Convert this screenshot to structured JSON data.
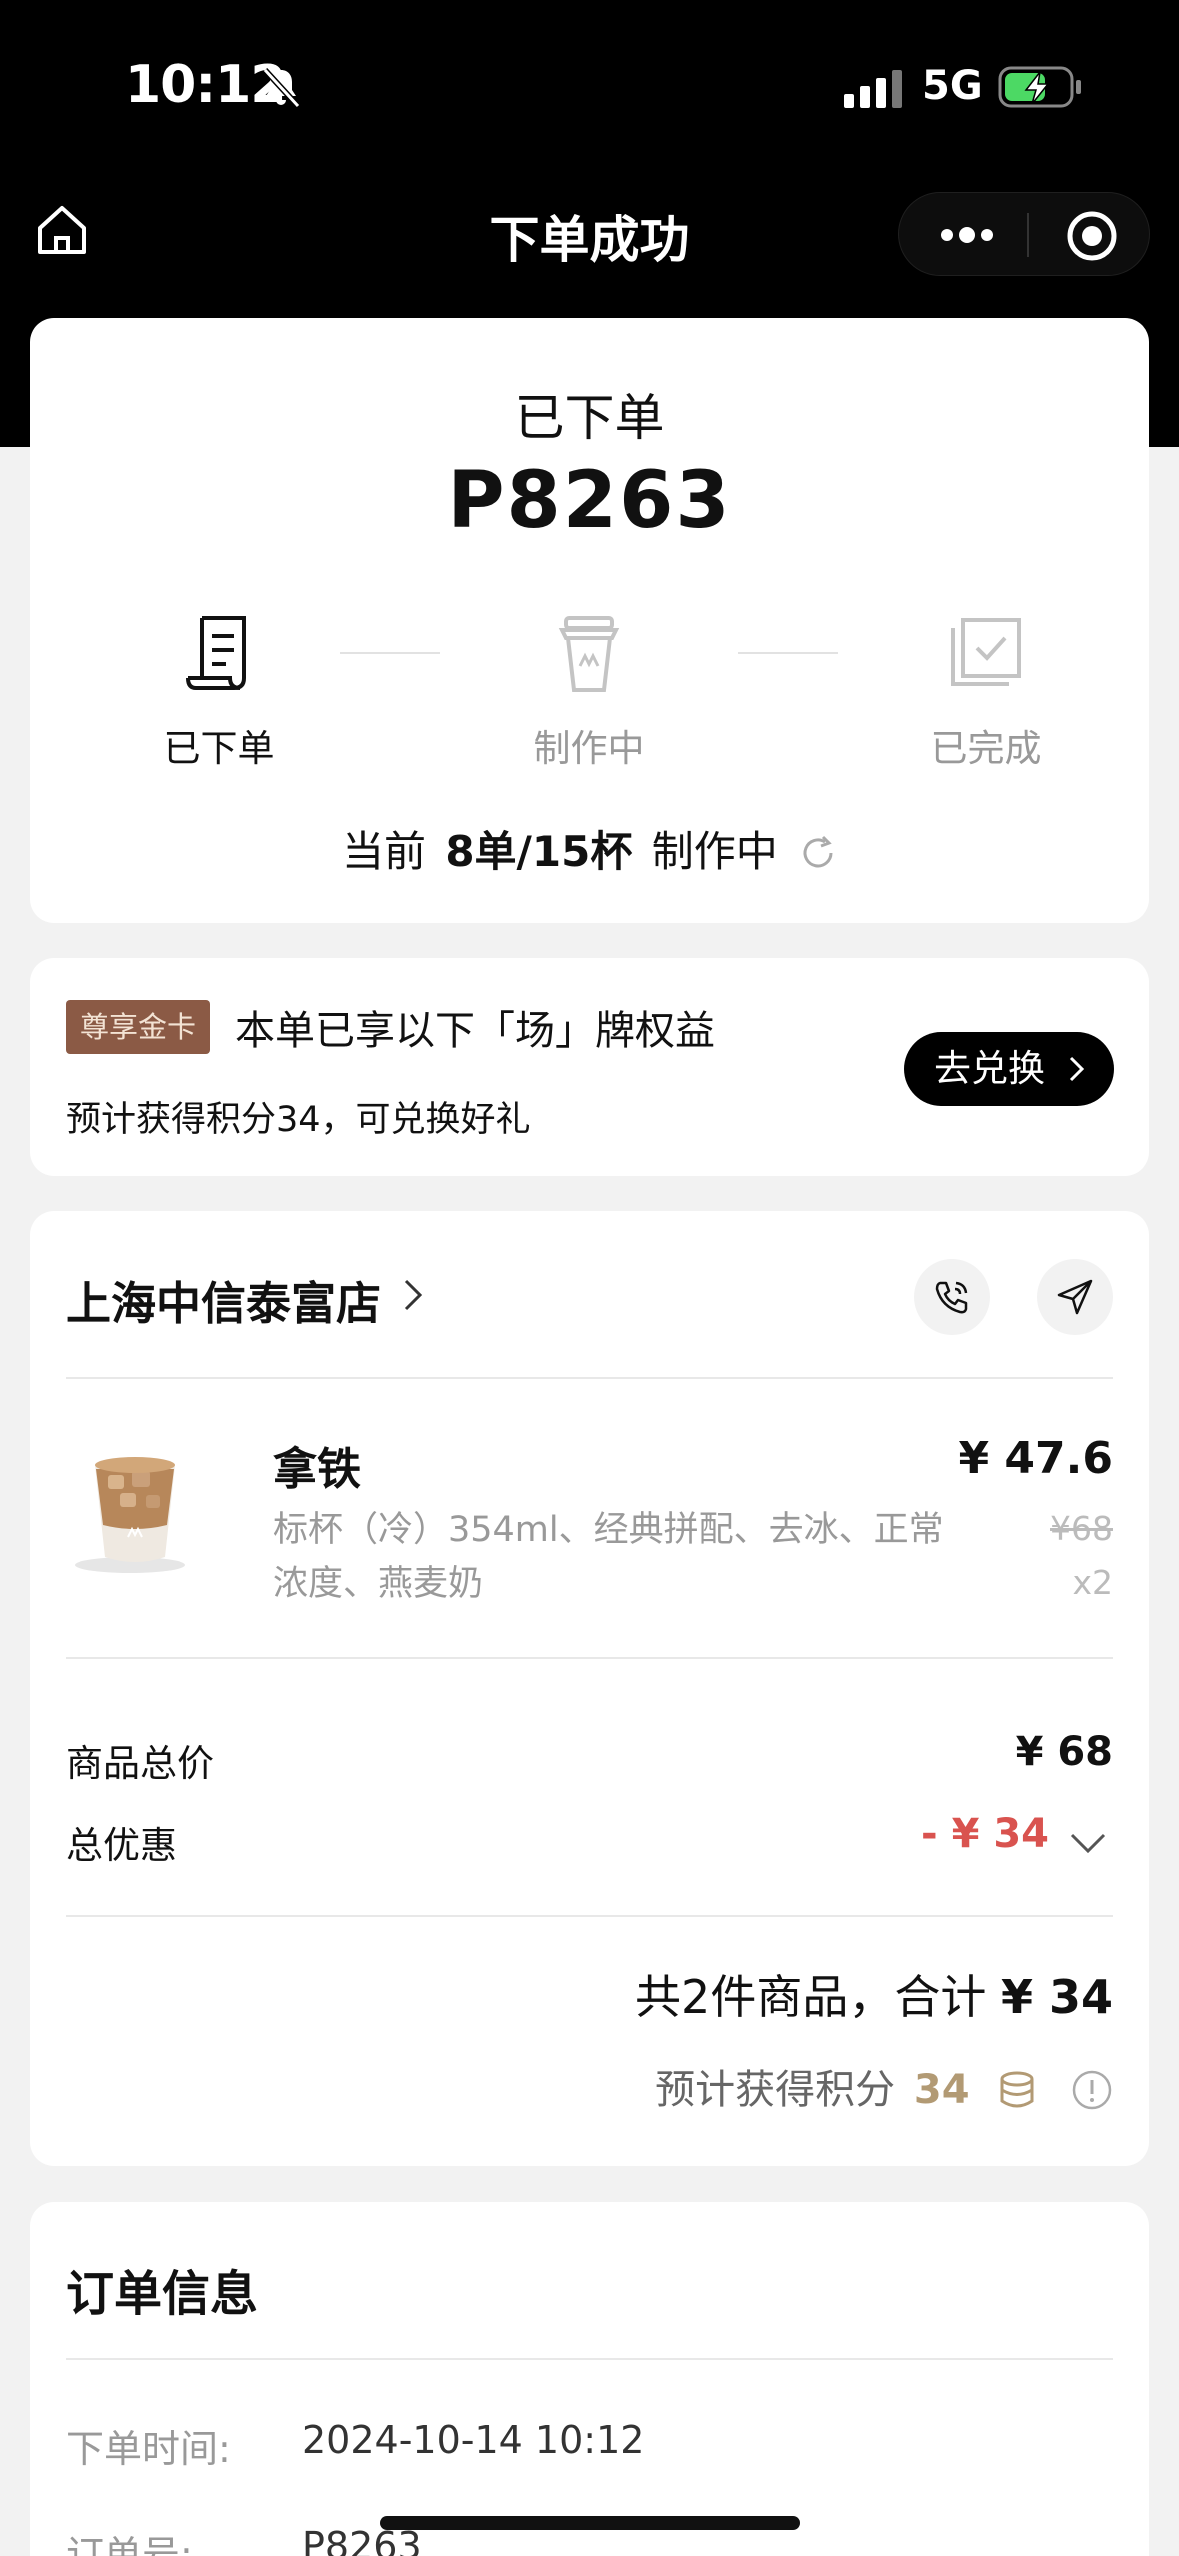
{
  "status_bar": {
    "time": "10:12",
    "network": "5G"
  },
  "nav": {
    "title": "下单成功"
  },
  "status_card": {
    "status": "已下单",
    "order_number": "P8263",
    "steps": [
      {
        "label": "已下单",
        "icon": "receipt-icon",
        "active": true
      },
      {
        "label": "制作中",
        "icon": "cup-icon",
        "active": false
      },
      {
        "label": "已完成",
        "icon": "check-box-icon",
        "active": false
      }
    ],
    "queue": {
      "prefix": "当前",
      "count": "8单/15杯",
      "suffix": "制作中"
    }
  },
  "member": {
    "badge": "尊享金卡",
    "title": "本单已享以下「场」牌权益",
    "subtitle": "预计获得积分34，可兑换好礼",
    "button": "去兑换"
  },
  "order": {
    "store": "上海中信泰富店",
    "product": {
      "name": "拿铁",
      "spec": "标杯（冷）354ml、经典拼配、去冰、正常浓度、燕麦奶",
      "price": "¥ 47.6",
      "original_price": "¥68",
      "quantity": "x2"
    },
    "subtotal_label": "商品总价",
    "subtotal": "¥ 68",
    "discount_label": "总优惠",
    "discount": "- ¥ 34",
    "total_prefix": "共2件商品，合计",
    "total": "¥ 34",
    "points_label": "预计获得积分",
    "points": "34"
  },
  "info": {
    "title": "订单信息",
    "rows": [
      {
        "label": "下单时间:",
        "value": "2024-10-14 10:12"
      },
      {
        "label": "订单号:",
        "value": "P8263"
      }
    ]
  },
  "colors": {
    "discount": "#d9534f",
    "badge_bg": "#8b5a45",
    "points": "#b29a74"
  }
}
